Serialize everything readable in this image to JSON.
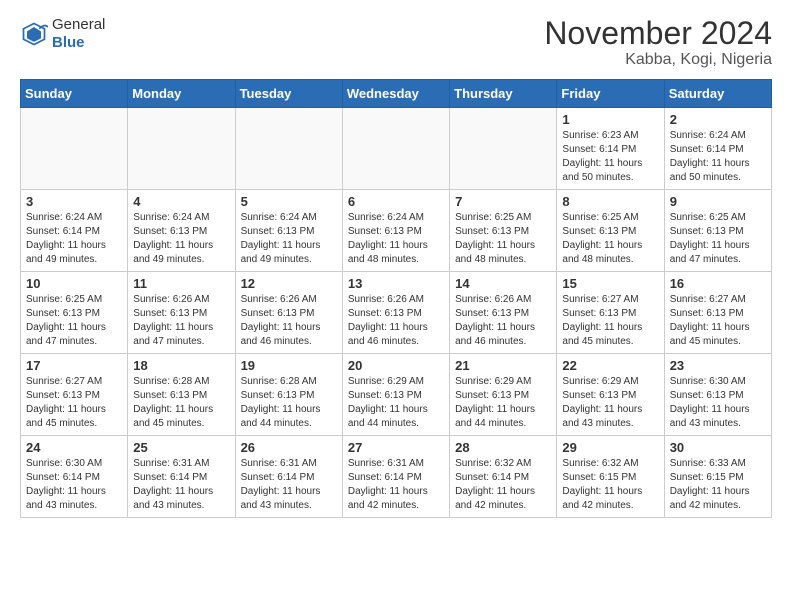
{
  "header": {
    "logo_general": "General",
    "logo_blue": "Blue",
    "month_title": "November 2024",
    "location": "Kabba, Kogi, Nigeria"
  },
  "weekdays": [
    "Sunday",
    "Monday",
    "Tuesday",
    "Wednesday",
    "Thursday",
    "Friday",
    "Saturday"
  ],
  "weeks": [
    [
      {
        "day": "",
        "info": ""
      },
      {
        "day": "",
        "info": ""
      },
      {
        "day": "",
        "info": ""
      },
      {
        "day": "",
        "info": ""
      },
      {
        "day": "",
        "info": ""
      },
      {
        "day": "1",
        "info": "Sunrise: 6:23 AM\nSunset: 6:14 PM\nDaylight: 11 hours and 50 minutes."
      },
      {
        "day": "2",
        "info": "Sunrise: 6:24 AM\nSunset: 6:14 PM\nDaylight: 11 hours and 50 minutes."
      }
    ],
    [
      {
        "day": "3",
        "info": "Sunrise: 6:24 AM\nSunset: 6:14 PM\nDaylight: 11 hours and 49 minutes."
      },
      {
        "day": "4",
        "info": "Sunrise: 6:24 AM\nSunset: 6:13 PM\nDaylight: 11 hours and 49 minutes."
      },
      {
        "day": "5",
        "info": "Sunrise: 6:24 AM\nSunset: 6:13 PM\nDaylight: 11 hours and 49 minutes."
      },
      {
        "day": "6",
        "info": "Sunrise: 6:24 AM\nSunset: 6:13 PM\nDaylight: 11 hours and 48 minutes."
      },
      {
        "day": "7",
        "info": "Sunrise: 6:25 AM\nSunset: 6:13 PM\nDaylight: 11 hours and 48 minutes."
      },
      {
        "day": "8",
        "info": "Sunrise: 6:25 AM\nSunset: 6:13 PM\nDaylight: 11 hours and 48 minutes."
      },
      {
        "day": "9",
        "info": "Sunrise: 6:25 AM\nSunset: 6:13 PM\nDaylight: 11 hours and 47 minutes."
      }
    ],
    [
      {
        "day": "10",
        "info": "Sunrise: 6:25 AM\nSunset: 6:13 PM\nDaylight: 11 hours and 47 minutes."
      },
      {
        "day": "11",
        "info": "Sunrise: 6:26 AM\nSunset: 6:13 PM\nDaylight: 11 hours and 47 minutes."
      },
      {
        "day": "12",
        "info": "Sunrise: 6:26 AM\nSunset: 6:13 PM\nDaylight: 11 hours and 46 minutes."
      },
      {
        "day": "13",
        "info": "Sunrise: 6:26 AM\nSunset: 6:13 PM\nDaylight: 11 hours and 46 minutes."
      },
      {
        "day": "14",
        "info": "Sunrise: 6:26 AM\nSunset: 6:13 PM\nDaylight: 11 hours and 46 minutes."
      },
      {
        "day": "15",
        "info": "Sunrise: 6:27 AM\nSunset: 6:13 PM\nDaylight: 11 hours and 45 minutes."
      },
      {
        "day": "16",
        "info": "Sunrise: 6:27 AM\nSunset: 6:13 PM\nDaylight: 11 hours and 45 minutes."
      }
    ],
    [
      {
        "day": "17",
        "info": "Sunrise: 6:27 AM\nSunset: 6:13 PM\nDaylight: 11 hours and 45 minutes."
      },
      {
        "day": "18",
        "info": "Sunrise: 6:28 AM\nSunset: 6:13 PM\nDaylight: 11 hours and 45 minutes."
      },
      {
        "day": "19",
        "info": "Sunrise: 6:28 AM\nSunset: 6:13 PM\nDaylight: 11 hours and 44 minutes."
      },
      {
        "day": "20",
        "info": "Sunrise: 6:29 AM\nSunset: 6:13 PM\nDaylight: 11 hours and 44 minutes."
      },
      {
        "day": "21",
        "info": "Sunrise: 6:29 AM\nSunset: 6:13 PM\nDaylight: 11 hours and 44 minutes."
      },
      {
        "day": "22",
        "info": "Sunrise: 6:29 AM\nSunset: 6:13 PM\nDaylight: 11 hours and 43 minutes."
      },
      {
        "day": "23",
        "info": "Sunrise: 6:30 AM\nSunset: 6:13 PM\nDaylight: 11 hours and 43 minutes."
      }
    ],
    [
      {
        "day": "24",
        "info": "Sunrise: 6:30 AM\nSunset: 6:14 PM\nDaylight: 11 hours and 43 minutes."
      },
      {
        "day": "25",
        "info": "Sunrise: 6:31 AM\nSunset: 6:14 PM\nDaylight: 11 hours and 43 minutes."
      },
      {
        "day": "26",
        "info": "Sunrise: 6:31 AM\nSunset: 6:14 PM\nDaylight: 11 hours and 43 minutes."
      },
      {
        "day": "27",
        "info": "Sunrise: 6:31 AM\nSunset: 6:14 PM\nDaylight: 11 hours and 42 minutes."
      },
      {
        "day": "28",
        "info": "Sunrise: 6:32 AM\nSunset: 6:14 PM\nDaylight: 11 hours and 42 minutes."
      },
      {
        "day": "29",
        "info": "Sunrise: 6:32 AM\nSunset: 6:15 PM\nDaylight: 11 hours and 42 minutes."
      },
      {
        "day": "30",
        "info": "Sunrise: 6:33 AM\nSunset: 6:15 PM\nDaylight: 11 hours and 42 minutes."
      }
    ]
  ]
}
